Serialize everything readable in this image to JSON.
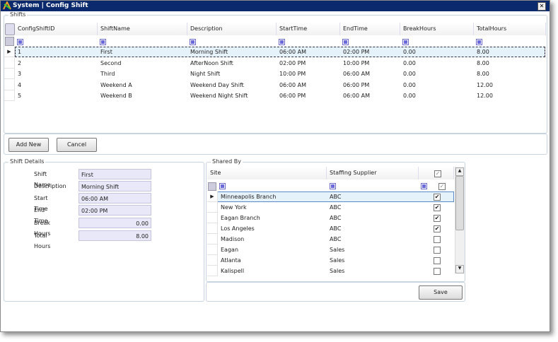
{
  "window": {
    "title": "System | Config Shift",
    "close": "✕"
  },
  "shifts": {
    "label": "Shifts",
    "columns": [
      "ConfigShiftID",
      "ShiftName",
      "Description",
      "StartTime",
      "EndTime",
      "BreakHours",
      "TotalHours"
    ],
    "rows": [
      [
        "1",
        "First",
        "Morning Shift",
        "06:00 AM",
        "02:00 PM",
        "0.00",
        "8.00"
      ],
      [
        "2",
        "Second",
        "AfterNoon Shift",
        "02:00 PM",
        "10:00 PM",
        "0.00",
        "8.00"
      ],
      [
        "3",
        "Third",
        "Night Shift",
        "10:00 PM",
        "06:00 AM",
        "0.00",
        "8.00"
      ],
      [
        "4",
        "Weekend A",
        "Weekend Day Shift",
        "06:00 AM",
        "06:00 PM",
        "0.00",
        "12.00"
      ],
      [
        "5",
        "Weekend B",
        "Weekend Night Shift",
        "06:00 PM",
        "06:00 AM",
        "0.00",
        "12.00"
      ]
    ],
    "selected_row": 0
  },
  "actions": {
    "add_new": "Add New",
    "cancel": "Cancel"
  },
  "details": {
    "label": "Shift Details",
    "fields": [
      {
        "label": "Shift Name",
        "value": "First"
      },
      {
        "label": "Description",
        "value": "Morning Shift"
      },
      {
        "label": "Start Time",
        "value": "06:00 AM"
      },
      {
        "label": "End Time",
        "value": "02:00 PM"
      },
      {
        "label": "Break Hours",
        "value": "0.00"
      },
      {
        "label": "Total Hours",
        "value": "8.00"
      }
    ]
  },
  "shared": {
    "label": "Shared By",
    "columns": [
      "Site",
      "Staffing Supplier"
    ],
    "rows": [
      {
        "site": "Minneapolis Branch",
        "supplier": "ABC",
        "checked": true
      },
      {
        "site": "New York",
        "supplier": "ABC",
        "checked": true
      },
      {
        "site": "Eagan Branch",
        "supplier": "ABC",
        "checked": true
      },
      {
        "site": "Los Angeles",
        "supplier": "ABC",
        "checked": true
      },
      {
        "site": "Madison",
        "supplier": "ABC",
        "checked": false
      },
      {
        "site": "Eagan",
        "supplier": "Sales",
        "checked": false
      },
      {
        "site": "Atlanta",
        "supplier": "Sales",
        "checked": false
      },
      {
        "site": "Kalispell",
        "supplier": "Sales",
        "checked": false
      }
    ]
  },
  "save": "Save",
  "colors": {
    "titlebar": "#0b2a6e",
    "selection": "#e6f2fa"
  }
}
